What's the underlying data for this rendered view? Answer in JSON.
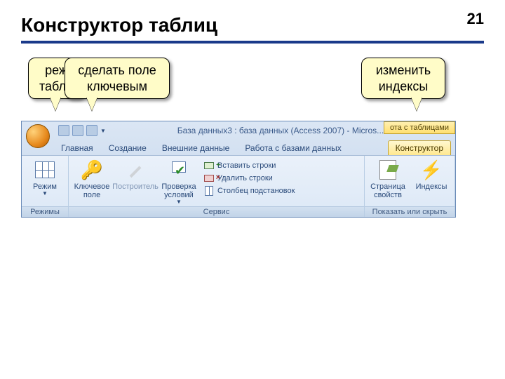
{
  "page_number": "21",
  "title": "Конструктор таблиц",
  "callouts": {
    "mode": "реж\nтабли",
    "keyfield": "сделать поле ключевым",
    "indexes": "изменить индексы"
  },
  "window": {
    "title": "База данных3 : база данных (Access 2007) - Micros...",
    "context_title": "ота с таблицами"
  },
  "tabs": {
    "home": "Главная",
    "create": "Создание",
    "external": "Внешние данные",
    "dbtools": "Работа с базами данных",
    "designer": "Конструктор"
  },
  "ribbon": {
    "modes_group": "Режимы",
    "mode_btn": "Режим",
    "service_group": "Сервис",
    "key_btn": "Ключевое поле",
    "builder_btn": "Построитель",
    "validate_btn": "Проверка условий",
    "insert_rows": "Вставить строки",
    "delete_rows": "Удалить строки",
    "lookup_col": "Столбец подстановок",
    "showhide_group": "Показать или скрыть",
    "prop_btn": "Страница свойств",
    "index_btn": "Индексы"
  }
}
